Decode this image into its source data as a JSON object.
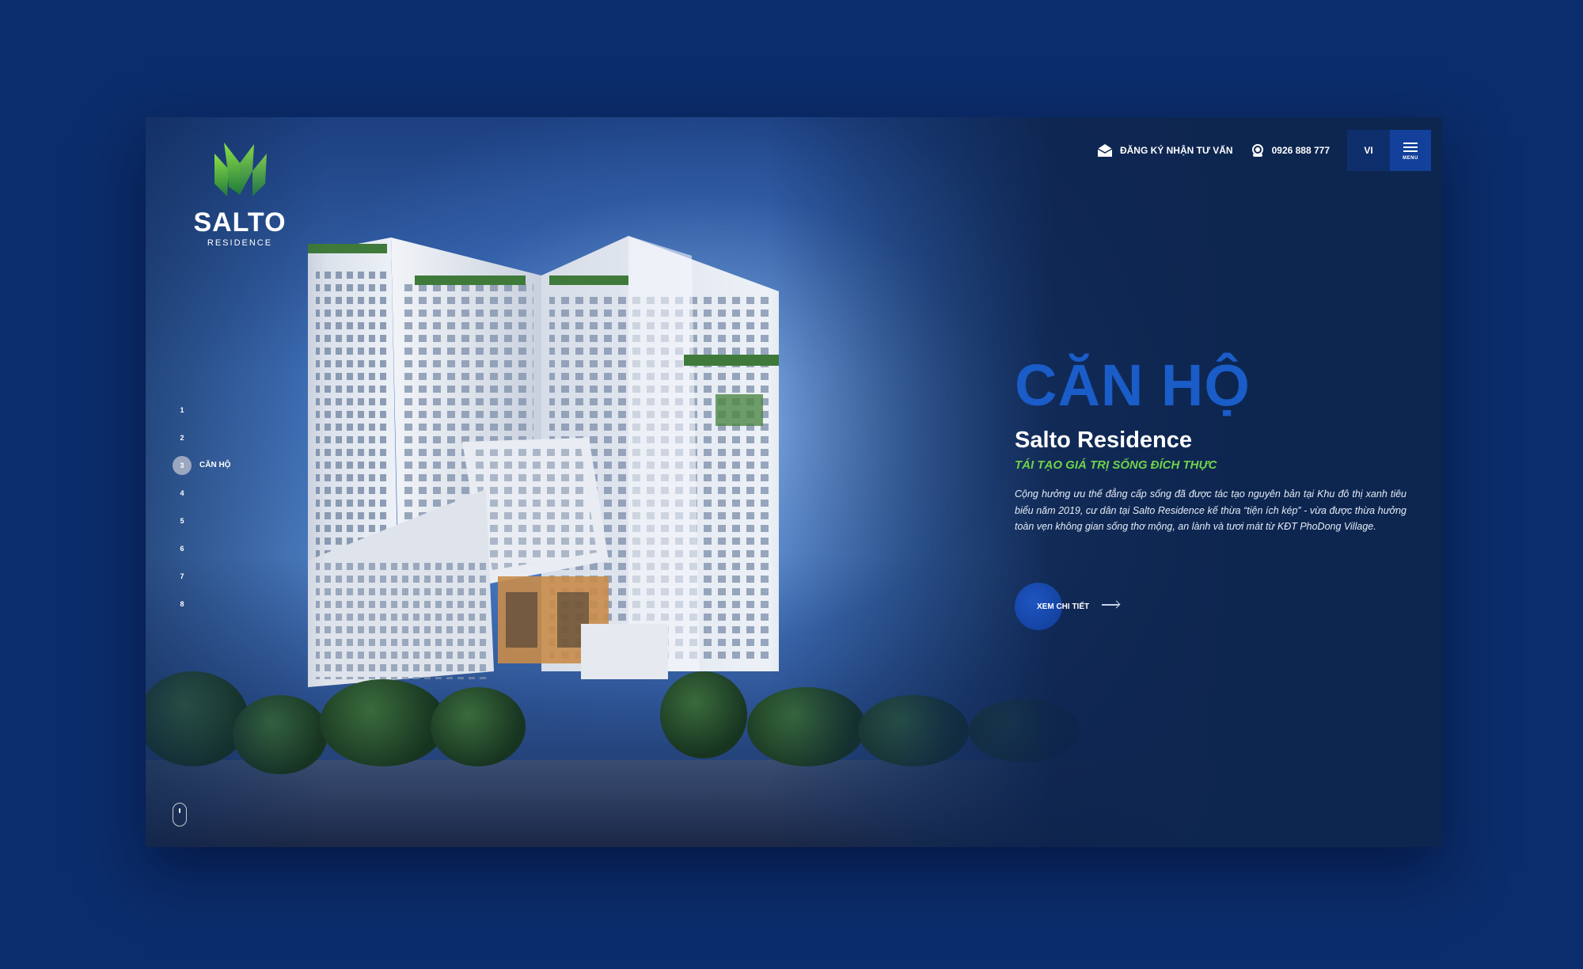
{
  "logo": {
    "name": "SALTO",
    "sub": "RESIDENCE"
  },
  "header": {
    "register_label": "ĐĂNG KÝ NHẬN TƯ VẤN",
    "phone": "0926 888 777",
    "language": "VI",
    "menu_label": "MENU"
  },
  "pager": {
    "items": [
      {
        "num": "1",
        "label": ""
      },
      {
        "num": "2",
        "label": ""
      },
      {
        "num": "3",
        "label": "CĂN HỘ",
        "active": true
      },
      {
        "num": "4",
        "label": ""
      },
      {
        "num": "5",
        "label": ""
      },
      {
        "num": "6",
        "label": ""
      },
      {
        "num": "7",
        "label": ""
      },
      {
        "num": "8",
        "label": ""
      }
    ]
  },
  "content": {
    "title": "CĂN HỘ",
    "subtitle": "Salto Residence",
    "tagline": "TÁI TẠO GIÁ TRỊ SỐNG ĐÍCH THỰC",
    "description": "Cộng hưởng ưu thế đẳng cấp sống đã được tác tạo nguyên bản tại Khu đô thị xanh tiêu biểu năm 2019, cư dân tại Salto Residence kế thừa “tiện ích kép” - vừa được thừa hưởng toàn vẹn không gian sống thơ mộng, an lành và tươi mát từ KĐT PhoDong Village.",
    "cta_label": "XEM CHI TIẾT"
  },
  "colors": {
    "page_bg": "#0b2d6b",
    "title_blue": "#1a5cc8",
    "tagline_green": "#6fd34a",
    "menu_blue": "#12409a"
  }
}
